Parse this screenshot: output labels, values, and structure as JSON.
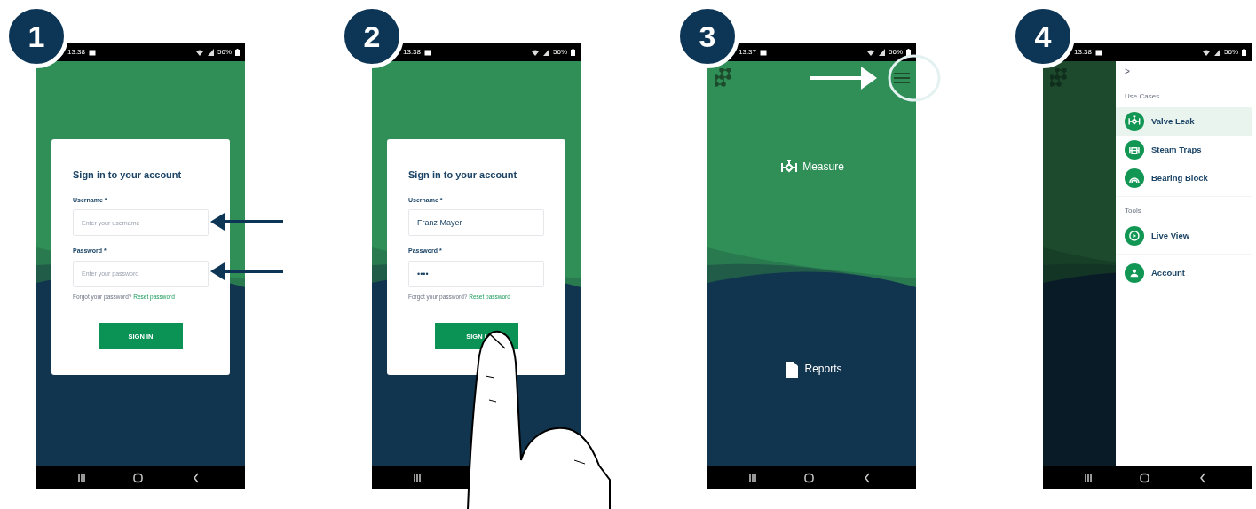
{
  "steps": [
    {
      "number": "1",
      "kind": "login",
      "annotation": {
        "kind": "field-arrows"
      },
      "status": {
        "time": "13:38",
        "battery": "56%"
      },
      "login": {
        "title": "Sign in to your account",
        "fields": [
          {
            "label": "Username *",
            "placeholder": "Enter your username"
          },
          {
            "label": "Password *",
            "placeholder": "Enter your password"
          }
        ],
        "forgot": "Forgot your password?",
        "reset_link": "Reset password",
        "button": "SIGN IN"
      }
    },
    {
      "number": "2",
      "kind": "login",
      "annotation": {
        "kind": "tap"
      },
      "status": {
        "time": "13:38",
        "battery": "56%"
      },
      "login": {
        "title": "Sign in to your account",
        "fields": [
          {
            "label": "Username *",
            "value": "Franz Mayer"
          },
          {
            "label": "Password *",
            "value": "••••"
          }
        ],
        "forgot": "Forgot your password?",
        "reset_link": "Reset password",
        "button": "SIGN I"
      }
    },
    {
      "number": "3",
      "kind": "home",
      "annotation": {
        "kind": "menu-highlight"
      },
      "status": {
        "time": "13:37",
        "battery": "56%"
      },
      "home": {
        "items": [
          {
            "label": "Measure",
            "kind": "valve"
          },
          {
            "label": "Reports",
            "kind": "document"
          }
        ]
      }
    },
    {
      "number": "4",
      "kind": "drawer",
      "status": {
        "time": "13:38",
        "battery": "56%"
      },
      "drawer": {
        "collapse_label": ">",
        "sections": [
          {
            "title": "Use Cases",
            "items": [
              {
                "label": "Valve Leak",
                "kind": "valve",
                "selected": true
              },
              {
                "label": "Steam Traps",
                "kind": "trap",
                "selected": false
              },
              {
                "label": "Bearing Block",
                "kind": "bearing",
                "selected": false
              }
            ]
          },
          {
            "title": "Tools",
            "items": [
              {
                "label": "Live View",
                "kind": "play",
                "selected": false
              }
            ]
          },
          {
            "items": [
              {
                "label": "Account",
                "kind": "person",
                "selected": false
              }
            ]
          }
        ]
      }
    }
  ]
}
